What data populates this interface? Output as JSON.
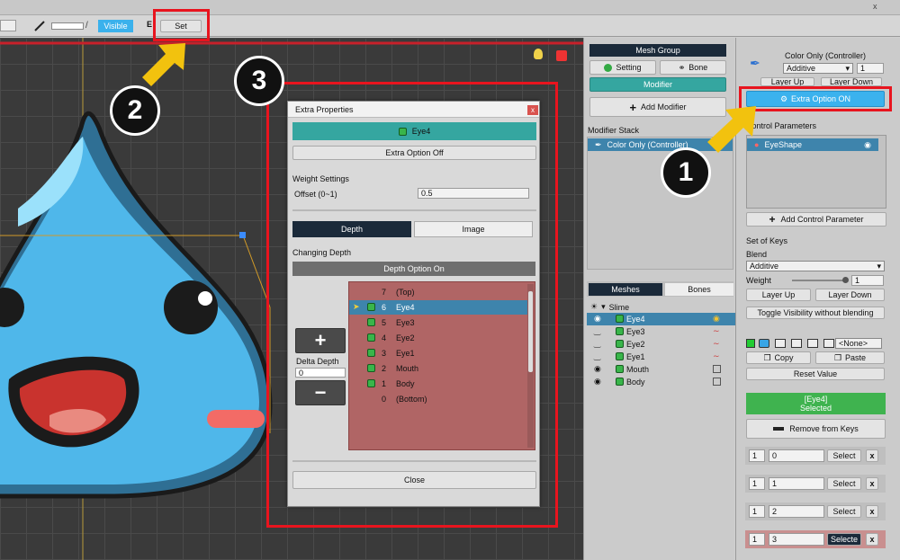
{
  "toolbar": {
    "visible_label": "Visible",
    "set_label": "Set"
  },
  "mesh_panel": {
    "title": "Mesh Group",
    "setting": "Setting",
    "bone": "Bone",
    "modifier": "Modifier",
    "add_modifier": "Add Modifier",
    "modifier_stack": "Modifier Stack",
    "stack_item": "Color Only (Controller)"
  },
  "tree": {
    "tabs": [
      "Meshes",
      "Bones"
    ],
    "root": "Slime",
    "items": [
      "Eye4",
      "Eye3",
      "Eye2",
      "Eye1",
      "Mouth",
      "Body"
    ]
  },
  "right": {
    "title": "Color Only (Controller)",
    "blend_mode": "Additive",
    "layer_value": "1",
    "layer_up": "Layer Up",
    "layer_down": "Layer Down",
    "extra_option": "Extra Option ON",
    "control_params": "Control Parameters",
    "param": "EyeShape",
    "add_param": "Add Control Parameter",
    "set_of_keys": "Set of Keys",
    "blend": "Blend",
    "blend_value": "Additive",
    "weight": "Weight",
    "weight_value": "1",
    "weight_level": 1,
    "toggle": "Toggle Visibility without blending",
    "none_option": "<None>",
    "copy": "Copy",
    "paste": "Paste",
    "reset": "Reset Value",
    "selected_name": "[Eye4]",
    "selected": "Selected",
    "remove": "Remove from Keys",
    "keys": [
      {
        "idx": "1",
        "val": "0",
        "btn": "Select"
      },
      {
        "idx": "1",
        "val": "1",
        "btn": "Select"
      },
      {
        "idx": "1",
        "val": "2",
        "btn": "Select"
      },
      {
        "idx": "1",
        "val": "3",
        "btn": "Selecte"
      }
    ]
  },
  "dialog": {
    "title": "Extra Properties",
    "close_x": "x",
    "target": "Eye4",
    "extra_off": "Extra Option Off",
    "weight_settings": "Weight Settings",
    "offset_label": "Offset (0~1)",
    "offset_value": "0.5",
    "tab_depth": "Depth",
    "tab_image": "Image",
    "changing_depth": "Changing Depth",
    "depth_option": "Depth Option On",
    "delta_depth": "Delta Depth",
    "delta_value": "0",
    "close": "Close",
    "depth_rows": [
      {
        "num": "7",
        "name": "(Top)"
      },
      {
        "num": "6",
        "name": "Eye4"
      },
      {
        "num": "5",
        "name": "Eye3"
      },
      {
        "num": "4",
        "name": "Eye2"
      },
      {
        "num": "3",
        "name": "Eye1"
      },
      {
        "num": "2",
        "name": "Mouth"
      },
      {
        "num": "1",
        "name": "Body"
      },
      {
        "num": "0",
        "name": "(Bottom)"
      }
    ]
  },
  "callouts": [
    "1",
    "2",
    "3"
  ],
  "colors": {
    "accent_teal": "#35a6a0",
    "highlight_blue": "#3e84ac",
    "red_box": "#e8141e",
    "depth_list": "#b06565",
    "extra_btn": "#3bb2ee"
  }
}
